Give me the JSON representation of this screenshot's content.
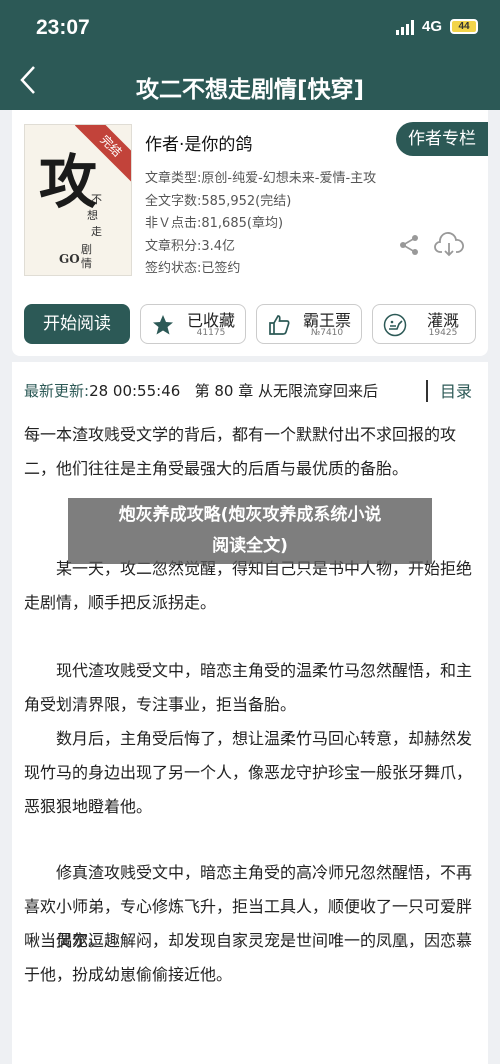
{
  "status": {
    "time": "23:07",
    "network": "4G",
    "battery": "44"
  },
  "header": {
    "title": "攻二不想走剧情[快穿]"
  },
  "book": {
    "author": "作者·是你的鸽",
    "author_button": "作者专栏",
    "meta": [
      "文章类型:原创-纯爱-幻想未来-爱情-主攻",
      "全文字数:585,952(完结)",
      "非Ｖ点击:81,685(章均)",
      "文章积分:3.4亿",
      "签约状态:已签约"
    ],
    "cover": {
      "title_big": "攻",
      "text1": "不",
      "text2": "想",
      "text3": "走",
      "text4": "剧",
      "text5": "情",
      "ribbon": "完结",
      "mark": "GO"
    }
  },
  "actions": {
    "start": "开始阅读",
    "collect": {
      "label": "已收藏",
      "count": "41175"
    },
    "ticket": {
      "label": "霸王票",
      "count": "№7410"
    },
    "water": {
      "label": "灌溉",
      "count": "19425"
    }
  },
  "reader": {
    "latest_label": "最新更新:",
    "latest_time": "28 00:55:46",
    "latest_chapter": "第 80 章 从无限流穿回来后",
    "toc": "目录",
    "paragraphs": [
      "每一本渣攻贱受文学的背后，都有一个默默付出不求回报的攻二，他们往往是主角受最强大的后盾与最优质的备胎。",
      "某一天，攻二忽然觉醒，得知自己只是书中人物，开始拒绝走剧情，顺手把反派拐走。",
      "现代渣攻贱受文中，暗恋主角受的温柔竹马忽然醒悟，和主角受划清界限，专注事业，拒当备胎。",
      "数月后，主角受后悔了，想让温柔竹马回心转意，却赫然发现竹马的身边出现了另一个人，像恶龙守护珍宝一般张牙舞爪，恶狠狠地瞪着他。",
      "修真渣攻贱受文中，暗恋主角受的高冷师兄忽然醒悟，不再喜欢小师弟，专心修炼飞升，拒当工具人，顺便收了一只可爱胖啾当灵宠。",
      "偶尔逗趣解闷，却发现自家灵宠是世间唯一的凤凰，因恋慕于他，扮成幼崽偷偷接近他。"
    ]
  },
  "overlay": {
    "line1": "炮灰养成攻略(炮灰攻养成系统小说",
    "line2": "阅读全文)"
  },
  "colors": {
    "accent": "#2c5956",
    "background": "#eef0f3"
  }
}
